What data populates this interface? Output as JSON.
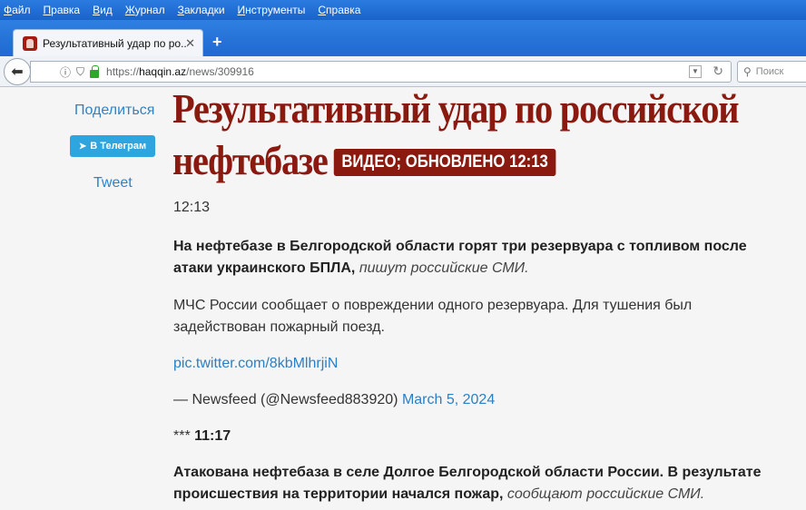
{
  "menu": [
    "Файл",
    "Правка",
    "Вид",
    "Журнал",
    "Закладки",
    "Инструменты",
    "Справка"
  ],
  "tab": {
    "title": "Результативный удар по ро...",
    "close": "✕",
    "new": "+"
  },
  "nav": {
    "url_prefix": "https://",
    "url_host": "haqqin.az",
    "url_path": "/news/309916",
    "search_placeholder": "Поиск"
  },
  "share": {
    "label": "Поделиться",
    "telegram": "В Телеграм",
    "tweet": "Tweet"
  },
  "article": {
    "headline": "Результативный удар по российской нефтебазе",
    "badge": "ВИДЕО; ОБНОВЛЕНО 12:13",
    "time": "12:13",
    "p1_bold": "На нефтебазе в Белгородской области горят три резервуара с топливом после атаки украинского БПЛА,",
    "p1_italic": "пишут российские СМИ.",
    "p2": "МЧС России сообщает о повреждении одного резервуара. Для тушения был задействован пожарный поезд.",
    "p3_link": "pic.twitter.com/8kbMlhrjiN",
    "p4_text": "— Newsfeed (@Newsfeed883920)",
    "p4_link": "March 5, 2024",
    "p5_stars": "***",
    "p5_time": "11:17",
    "p6_bold": "Атакована нефтебаза в селе Долгое Белгородской области России. В результате происшествия на территории начался пожар,",
    "p6_italic": "сообщают российские СМИ."
  }
}
